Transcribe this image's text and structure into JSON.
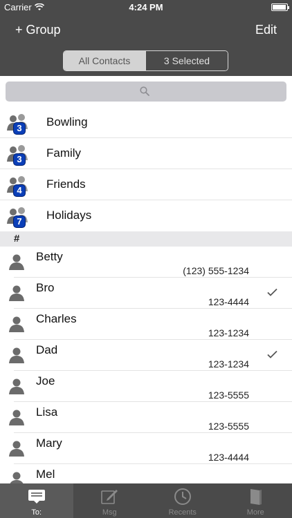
{
  "status_bar": {
    "carrier": "Carrier",
    "time": "4:24 PM"
  },
  "nav": {
    "left_button": "+ Group",
    "right_button": "Edit"
  },
  "segmented": {
    "options": [
      "All Contacts",
      "3 Selected"
    ],
    "selected": "All Contacts"
  },
  "search": {
    "icon": "search-icon"
  },
  "groups": [
    {
      "name": "Bowling",
      "count": "3"
    },
    {
      "name": "Family",
      "count": "3"
    },
    {
      "name": "Friends",
      "count": "4"
    },
    {
      "name": "Holidays",
      "count": "7"
    }
  ],
  "section_header": "#",
  "contacts": [
    {
      "name": "Betty",
      "phone": "(123) 555-1234",
      "selected": false
    },
    {
      "name": "Bro",
      "phone": "123-4444",
      "selected": true
    },
    {
      "name": "Charles",
      "phone": "123-1234",
      "selected": false
    },
    {
      "name": "Dad",
      "phone": "123-1234",
      "selected": true
    },
    {
      "name": "Joe",
      "phone": "123-5555",
      "selected": false
    },
    {
      "name": "Lisa",
      "phone": "123-5555",
      "selected": false
    },
    {
      "name": "Mary",
      "phone": "123-4444",
      "selected": false
    },
    {
      "name": "Mel",
      "phone": "",
      "selected": false
    }
  ],
  "tabs": [
    {
      "label": "To:",
      "icon": "message-list-icon",
      "active": true
    },
    {
      "label": "Msg",
      "icon": "compose-icon",
      "active": false
    },
    {
      "label": "Recents",
      "icon": "clock-icon",
      "active": false
    },
    {
      "label": "More",
      "icon": "book-icon",
      "active": false
    }
  ],
  "colors": {
    "header_bg": "#4a4a4a",
    "badge_blue": "#0b3fb8",
    "section_bg": "#e8e8ea"
  }
}
